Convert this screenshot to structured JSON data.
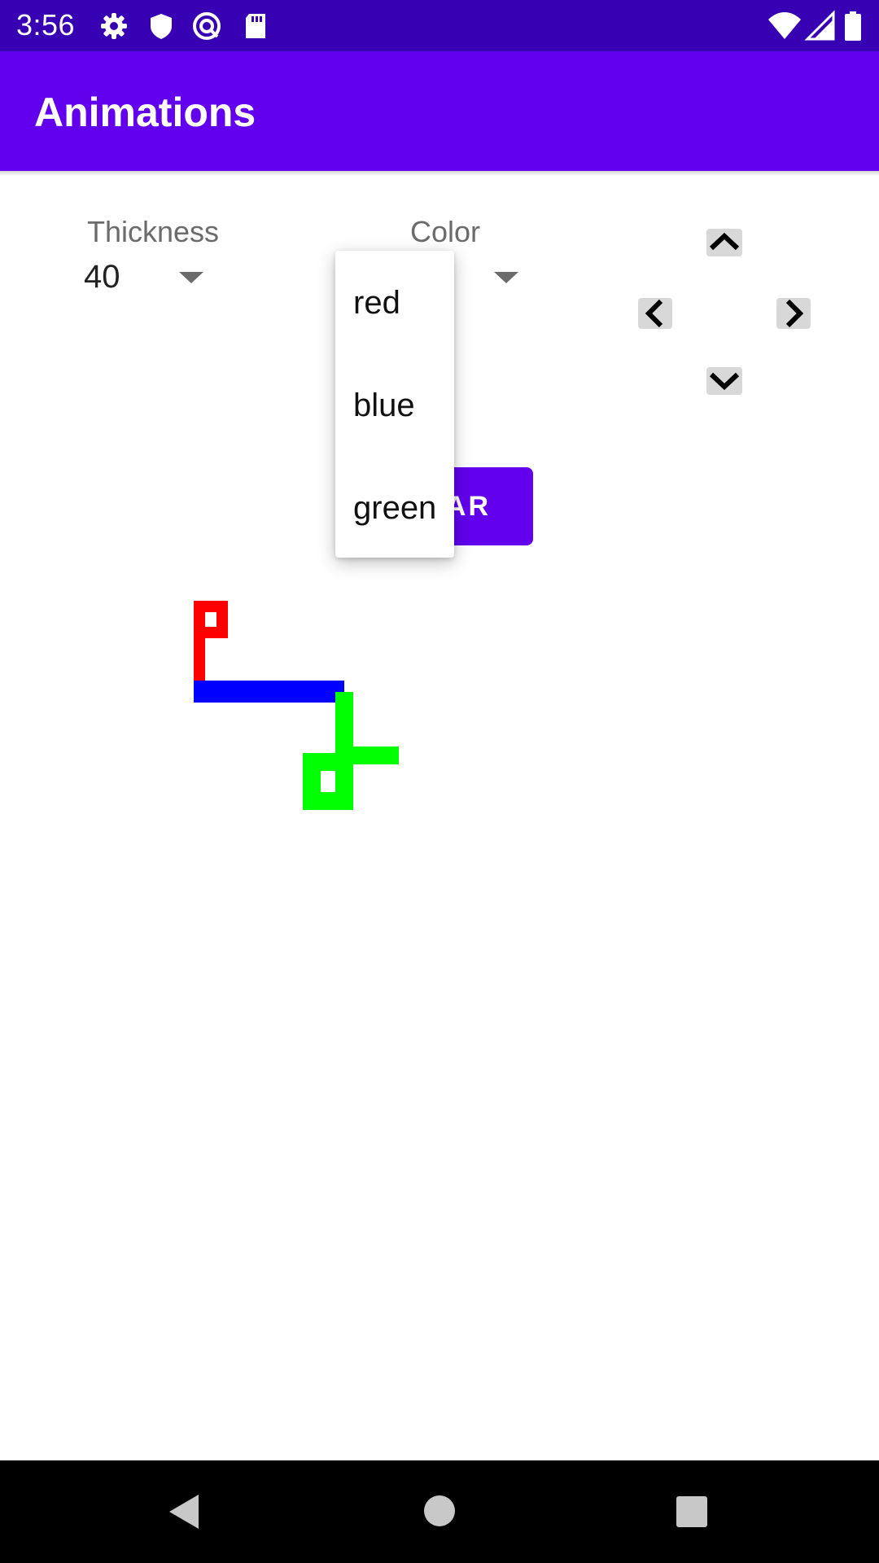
{
  "status_bar": {
    "time": "3:56",
    "left_icons": [
      "gear-icon",
      "shield-icon",
      "at-sign-icon",
      "sd-card-icon"
    ],
    "right_icons": [
      "wifi-icon",
      "signal-icon",
      "battery-icon"
    ]
  },
  "app_bar": {
    "title": "Animations"
  },
  "controls": {
    "thickness": {
      "label": "Thickness",
      "value": "40"
    },
    "color": {
      "label": "Color",
      "options": [
        "red",
        "blue",
        "green"
      ]
    },
    "clear_button": {
      "visible_label": "AR"
    },
    "dpad": [
      "chevron-up-icon",
      "chevron-left-icon",
      "chevron-right-icon",
      "chevron-down-icon"
    ]
  },
  "drawing": {
    "stroke_colors": {
      "red": "#ff0000",
      "blue": "#0000ff",
      "green": "#00ff00"
    }
  },
  "nav_bar": {
    "buttons": [
      "back-icon",
      "home-icon",
      "recents-icon"
    ]
  },
  "colors": {
    "status_bar": "#3700b3",
    "app_bar": "#6200ee",
    "accent": "#6200ee"
  }
}
